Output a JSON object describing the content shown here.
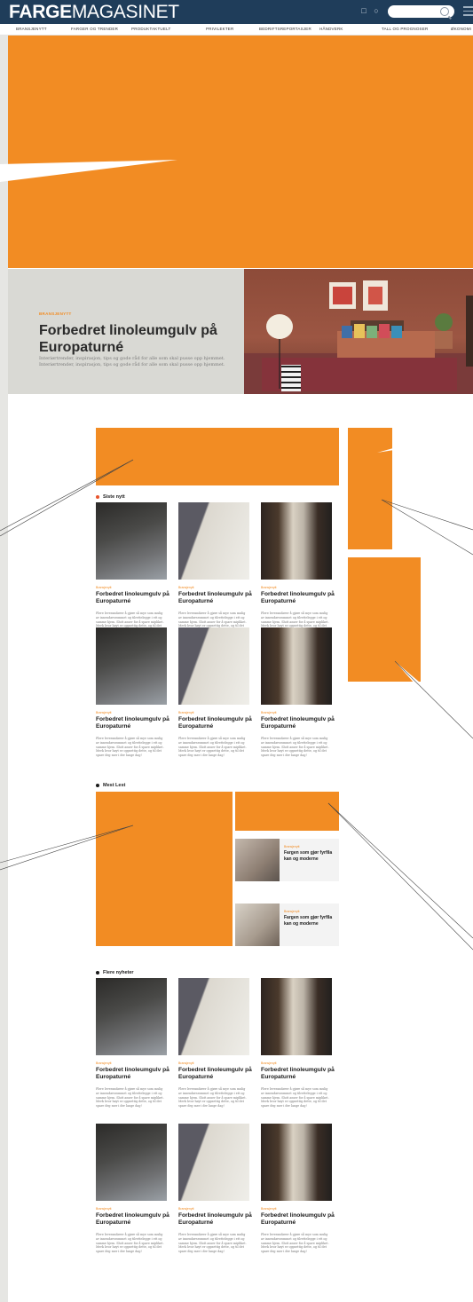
{
  "header": {
    "logo_bold": "FARGE",
    "logo_light": "MAGASINET",
    "nav": [
      "BRANSJENYTT",
      "FARGER OG TRENDER",
      "PRODUKTAKTUELT",
      "PRIVILEKTER",
      "BEDRIFTSREPORTASJER",
      "HÅNDVERK",
      "TALL OG PROGNOSER",
      "ØKONOMI"
    ]
  },
  "hero": {
    "kicker": "BRANSJENYTT",
    "title": "Forbedret linoleumgulv på Europaturné",
    "desc": "Interiørtrender, inspirasjon, tips og gode råd for alle som skal pusse opp hjemmet. Interiørtrender, inspirasjon, tips og gode råd for alle som skal pusse opp hjemmet."
  },
  "sections": {
    "latest": "Siste nytt",
    "most_read": "Mest Lest",
    "more": "Flere nyheter"
  },
  "card": {
    "kicker": "Bransjenytt",
    "title": "Forbedret linoleumgulv på Europaturné",
    "desc": "Flere leverandører å gjøre så mye som mulig av innendørsrommet og tilrettelegge i ett og samme hjem. Slutt anser for å spare mipliket. Merk hvor høyt er oppsettig dette, og til det spare deg mer i der lange dag!"
  },
  "most_read_items": [
    {
      "kicker": "Bransjenytt",
      "title": "Fargen som gjør fyrfila kan og moderne"
    },
    {
      "kicker": "Bransjenytt",
      "title": "Fargen som gjør fyrfila kan og moderne"
    }
  ],
  "colors": {
    "accent": "#f28c23",
    "header": "#1f3d5a",
    "hero_bg": "#d9d9d4"
  }
}
